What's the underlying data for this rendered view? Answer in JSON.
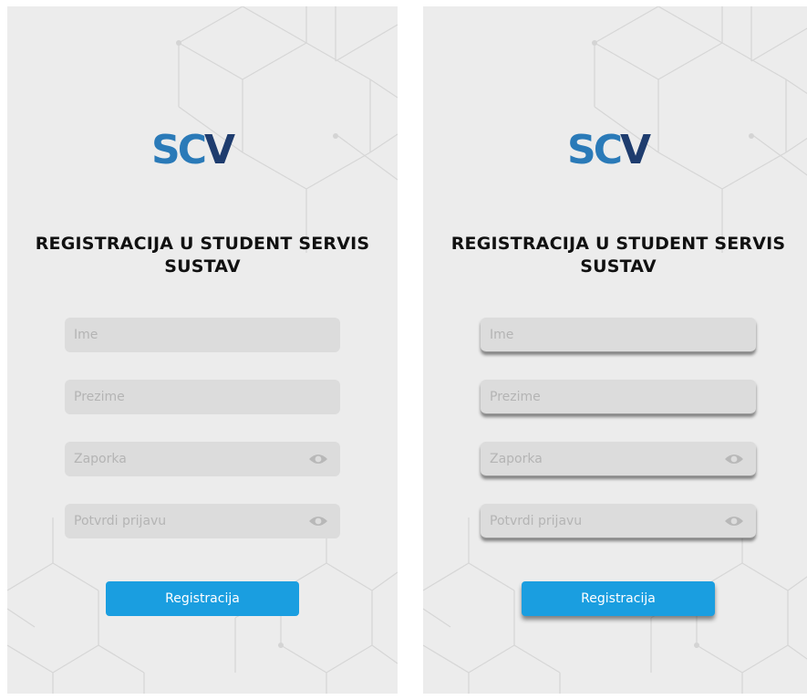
{
  "screens": [
    {
      "variant": "flat",
      "logo": {
        "part1": "SC",
        "part2": "V",
        "color1": "#2a7ab8",
        "color2": "#1e3c6e"
      },
      "title": "REGISTRACIJA U STUDENT SERVIS SUSTAV",
      "fields": {
        "first_name": {
          "placeholder": "Ime"
        },
        "last_name": {
          "placeholder": "Prezime"
        },
        "password": {
          "placeholder": "Zaporka",
          "icon": "eye-icon"
        },
        "confirm": {
          "placeholder": "Potvrdi prijavu",
          "icon": "eye-icon"
        }
      },
      "button": {
        "label": "Registracija",
        "color": "#1a9ee0"
      }
    },
    {
      "variant": "shadowed",
      "logo": {
        "part1": "SC",
        "part2": "V",
        "color1": "#2a7ab8",
        "color2": "#1e3c6e"
      },
      "title": "REGISTRACIJA U STUDENT SERVIS SUSTAV",
      "fields": {
        "first_name": {
          "placeholder": "Ime"
        },
        "last_name": {
          "placeholder": "Prezime"
        },
        "password": {
          "placeholder": "Zaporka",
          "icon": "eye-icon"
        },
        "confirm": {
          "placeholder": "Potvrdi prijavu",
          "icon": "eye-icon"
        }
      },
      "button": {
        "label": "Registracija",
        "color": "#1a9ee0"
      }
    }
  ]
}
